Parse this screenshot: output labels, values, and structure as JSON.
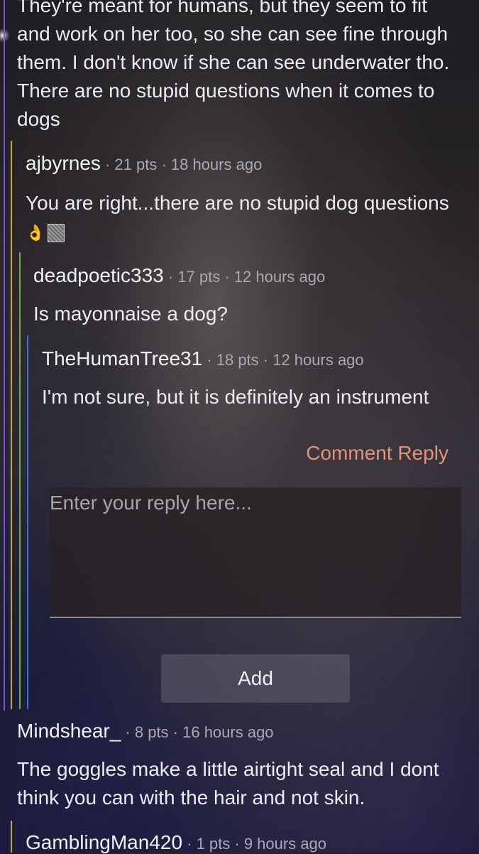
{
  "thread": {
    "top_comment_text": "They're meant for humans, but they seem to fit and work on her too, so she can see fine through them. I don't know if she can see underwater tho. There are no stupid questions when it comes to dogs",
    "c1": {
      "author": "ajbyrnes",
      "meta": " · 21 pts · 18 hours ago",
      "text": "You are right...there are no stupid dog questions",
      "emoji": "👌"
    },
    "c2": {
      "author": "deadpoetic333",
      "meta": " · 17 pts · 12 hours ago",
      "text": "Is mayonnaise a dog?"
    },
    "c3": {
      "author": "TheHumanTree31",
      "meta": " · 18 pts · 12 hours ago",
      "text": "I'm not sure, but it is definitely an instrument"
    },
    "reply": {
      "comment_reply_label": "Comment Reply",
      "placeholder": "Enter your reply here...",
      "add_label": "Add"
    },
    "c4": {
      "author": "Mindshear_",
      "meta": " · 8 pts · 16 hours ago",
      "text": "The goggles make a little airtight seal and I dont think you can with the hair and not skin."
    },
    "c5": {
      "author": "GamblingMan420",
      "meta": " · 1 pts · 9 hours ago"
    }
  },
  "colors": {
    "depth1": "#c7a82a",
    "depth2": "#b9b02a",
    "depth3": "#2fa35a",
    "depth4": "#3c6ed6",
    "outer": "#7a4fd0",
    "accent": "#e3917a"
  }
}
